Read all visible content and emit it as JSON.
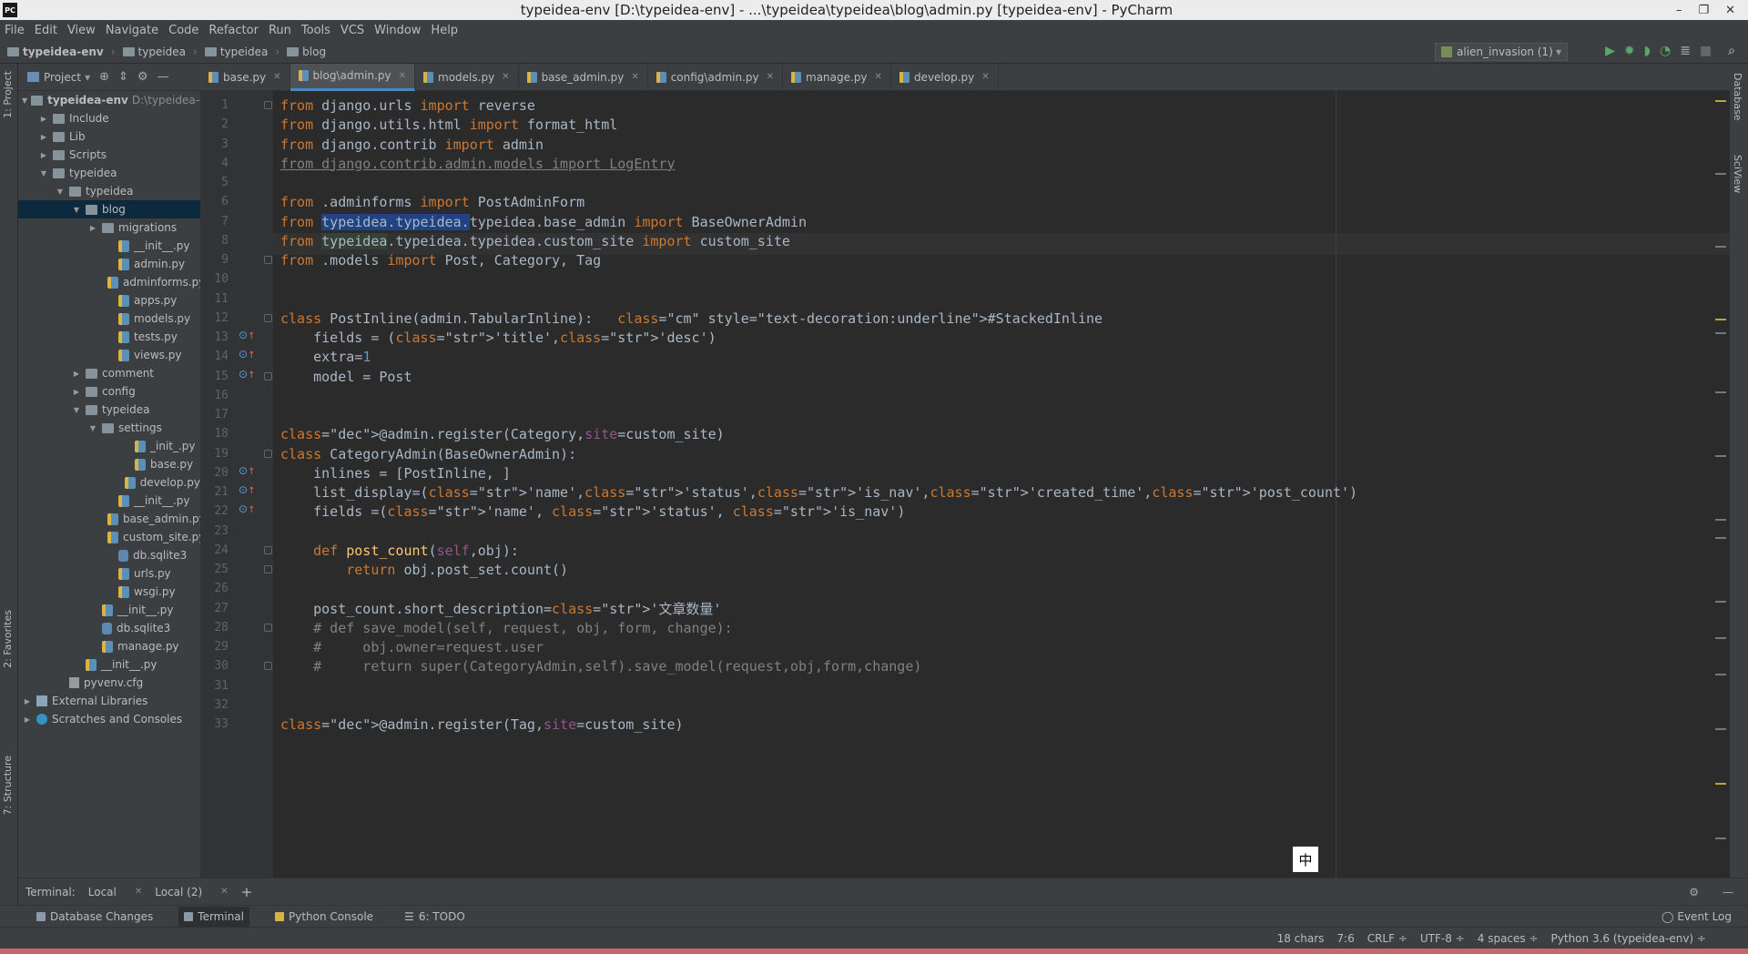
{
  "window": {
    "title": "typeidea-env [D:\\typeidea-env] - ...\\typeidea\\typeidea\\blog\\admin.py [typeidea-env] - PyCharm",
    "app_icon": "PC"
  },
  "menu": [
    "File",
    "Edit",
    "View",
    "Navigate",
    "Code",
    "Refactor",
    "Run",
    "Tools",
    "VCS",
    "Window",
    "Help"
  ],
  "breadcrumbs": [
    "typeidea-env",
    "typeidea",
    "typeidea",
    "blog"
  ],
  "run_config": "alien_invasion (1)",
  "project_panel": {
    "title": "Project",
    "tree": [
      {
        "label": "typeidea-env",
        "hint": "D:\\typeidea-env",
        "depth": 0,
        "kind": "folder",
        "arrow": "▼"
      },
      {
        "label": "Include",
        "depth": 1,
        "kind": "folder",
        "arrow": "▶"
      },
      {
        "label": "Lib",
        "depth": 1,
        "kind": "folder",
        "arrow": "▶"
      },
      {
        "label": "Scripts",
        "depth": 1,
        "kind": "folder",
        "arrow": "▶"
      },
      {
        "label": "typeidea",
        "depth": 1,
        "kind": "folder",
        "arrow": "▼"
      },
      {
        "label": "typeidea",
        "depth": 2,
        "kind": "folder",
        "arrow": "▼"
      },
      {
        "label": "blog",
        "depth": 3,
        "kind": "folder",
        "arrow": "▼",
        "selected": true
      },
      {
        "label": "migrations",
        "depth": 4,
        "kind": "folder",
        "arrow": "▶"
      },
      {
        "label": "__init__.py",
        "depth": 5,
        "kind": "py"
      },
      {
        "label": "admin.py",
        "depth": 5,
        "kind": "py"
      },
      {
        "label": "adminforms.py",
        "depth": 5,
        "kind": "py"
      },
      {
        "label": "apps.py",
        "depth": 5,
        "kind": "py"
      },
      {
        "label": "models.py",
        "depth": 5,
        "kind": "py"
      },
      {
        "label": "tests.py",
        "depth": 5,
        "kind": "py"
      },
      {
        "label": "views.py",
        "depth": 5,
        "kind": "py"
      },
      {
        "label": "comment",
        "depth": 3,
        "kind": "folder",
        "arrow": "▶"
      },
      {
        "label": "config",
        "depth": 3,
        "kind": "folder",
        "arrow": "▶"
      },
      {
        "label": "typeidea",
        "depth": 3,
        "kind": "folder",
        "arrow": "▼"
      },
      {
        "label": "settings",
        "depth": 4,
        "kind": "folder",
        "arrow": "▼"
      },
      {
        "label": "_init_.py",
        "depth": 6,
        "kind": "py"
      },
      {
        "label": "base.py",
        "depth": 6,
        "kind": "py"
      },
      {
        "label": "develop.py",
        "depth": 6,
        "kind": "py"
      },
      {
        "label": "__init__.py",
        "depth": 5,
        "kind": "py"
      },
      {
        "label": "base_admin.py",
        "depth": 5,
        "kind": "py"
      },
      {
        "label": "custom_site.py",
        "depth": 5,
        "kind": "py"
      },
      {
        "label": "db.sqlite3",
        "depth": 5,
        "kind": "db"
      },
      {
        "label": "urls.py",
        "depth": 5,
        "kind": "py"
      },
      {
        "label": "wsgi.py",
        "depth": 5,
        "kind": "py"
      },
      {
        "label": "__init__.py",
        "depth": 4,
        "kind": "py"
      },
      {
        "label": "db.sqlite3",
        "depth": 4,
        "kind": "db"
      },
      {
        "label": "manage.py",
        "depth": 4,
        "kind": "py"
      },
      {
        "label": "__init__.py",
        "depth": 3,
        "kind": "py"
      },
      {
        "label": "pyvenv.cfg",
        "depth": 2,
        "kind": "cfg"
      },
      {
        "label": "External Libraries",
        "depth": 0,
        "kind": "lib",
        "arrow": "▶"
      },
      {
        "label": "Scratches and Consoles",
        "depth": 0,
        "kind": "scr",
        "arrow": "▶"
      }
    ]
  },
  "tabs": [
    {
      "label": "base.py",
      "active": false
    },
    {
      "label": "blog\\admin.py",
      "active": true
    },
    {
      "label": "models.py",
      "active": false
    },
    {
      "label": "base_admin.py",
      "active": false
    },
    {
      "label": "config\\admin.py",
      "active": false
    },
    {
      "label": "manage.py",
      "active": false
    },
    {
      "label": "develop.py",
      "active": false
    }
  ],
  "code_lines": [
    "from django.urls import reverse",
    "from django.utils.html import format_html",
    "from django.contrib import admin",
    "from django.contrib.admin.models import LogEntry",
    "",
    "from .adminforms import PostAdminForm",
    "from typeidea.typeidea.typeidea.base_admin import BaseOwnerAdmin",
    "from typeidea.typeidea.typeidea.custom_site import custom_site",
    "from .models import Post, Category, Tag",
    "",
    "",
    "class PostInline(admin.TabularInline):   #StackedInline",
    "    fields = ('title','desc')",
    "    extra=1",
    "    model = Post",
    "",
    "",
    "@admin.register(Category,site=custom_site)",
    "class CategoryAdmin(BaseOwnerAdmin):",
    "    inlines = [PostInline, ]",
    "    list_display=('name','status','is_nav','created_time','post_count')",
    "    fields =('name', 'status', 'is_nav')",
    "",
    "    def post_count(self,obj):",
    "        return obj.post_set.count()",
    "",
    "    post_count.short_description='文章数量'",
    "    # def save_model(self, request, obj, form, change):",
    "    #     obj.owner=request.user",
    "    #     return super(CategoryAdmin,self).save_model(request,obj,form,change)",
    "",
    "",
    "@admin.register(Tag,site=custom_site)"
  ],
  "ime_indicator": "中",
  "terminal": {
    "label": "Terminal:",
    "tabs": [
      "Local",
      "Local (2)"
    ],
    "add": "+"
  },
  "bottom_tools": [
    "Database Changes",
    "Terminal",
    "Python Console",
    "6: TODO"
  ],
  "event_log": "Event Log",
  "status": [
    "18 chars",
    "7:6",
    "CRLF ÷",
    "UTF-8 ÷",
    "4 spaces ÷",
    "Python 3.6 (typeidea-env) ÷"
  ],
  "side_tabs": {
    "left_top": "1: Project",
    "left_mid": "2: Favorites",
    "left_bot": "7: Structure",
    "right_top": "Database",
    "right_mid": "SciView"
  }
}
